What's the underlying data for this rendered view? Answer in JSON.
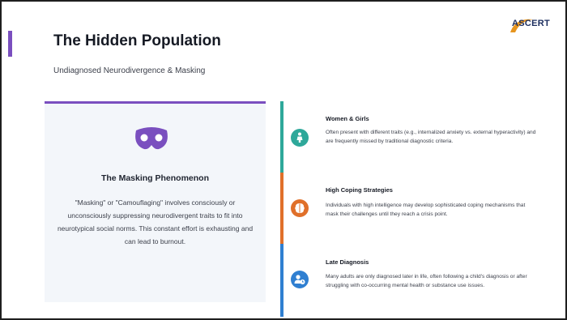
{
  "header": {
    "title": "The Hidden Population",
    "subtitle": "Undiagnosed Neurodivergence & Masking"
  },
  "logo": {
    "text": "ASCERT",
    "color": "#1b2d5e",
    "accent": "#e6951f"
  },
  "masking_card": {
    "icon": "theater-mask-icon",
    "title": "The Masking Phenomenon",
    "body": "\"Masking\" or \"Camouflaging\" involves consciously or unconsciously suppressing neurodivergent traits to fit into neurotypical social norms. This constant effort is exhausting and can lead to burnout.",
    "accent_color": "#7a4fbf"
  },
  "items": [
    {
      "icon": "female-icon",
      "title": "Women & Girls",
      "body": "Often present with different traits (e.g., internalized anxiety vs. external hyperactivity) and are frequently missed by traditional diagnostic criteria.",
      "color": "#2ea89a"
    },
    {
      "icon": "brain-icon",
      "title": "High Coping Strategies",
      "body": "Individuals with high intelligence may develop sophisticated coping mechanisms that mask their challenges until they reach a crisis point.",
      "color": "#e0702a"
    },
    {
      "icon": "user-clock-icon",
      "title": "Late Diagnosis",
      "body": "Many adults are only diagnosed later in life, often following a child's diagnosis or after struggling with co-occurring mental health or substance use issues.",
      "color": "#2f7fd1"
    }
  ]
}
